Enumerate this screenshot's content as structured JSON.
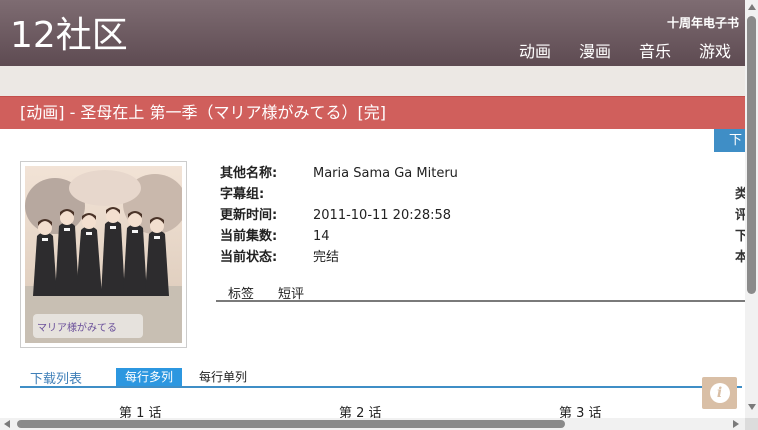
{
  "header": {
    "logo": "12社区",
    "promo": "十周年电子书",
    "nav": [
      "动画",
      "漫画",
      "音乐",
      "游戏"
    ]
  },
  "title": "[动画] - 圣母在上 第一季（マリア様がみてる）[完]",
  "download_button": "下",
  "cover": {
    "caption_logo": "マリア様がみてる"
  },
  "info": {
    "fields": [
      {
        "label": "其他名称:",
        "value": "Maria Sama Ga Miteru"
      },
      {
        "label": "字幕组:",
        "value": ""
      },
      {
        "label": "更新时间:",
        "value": "2011-10-11 20:28:58"
      },
      {
        "label": "当前集数:",
        "value": "14"
      },
      {
        "label": "当前状态:",
        "value": "完结"
      }
    ],
    "right_column": [
      "类",
      "评",
      "下",
      "本"
    ]
  },
  "sub_tabs": [
    "标签",
    "短评"
  ],
  "download_list": {
    "tab_label": "下载列表",
    "modes": [
      "每行多列",
      "每行单列"
    ],
    "episodes": [
      "第 1 话",
      "第 2 话",
      "第 3 话"
    ]
  },
  "info_icon": "i",
  "colors": {
    "header": "#6e5a61",
    "title_bar": "#d05f5c",
    "accent_blue": "#3f8ec6",
    "info_button": "#d9bfa6"
  }
}
